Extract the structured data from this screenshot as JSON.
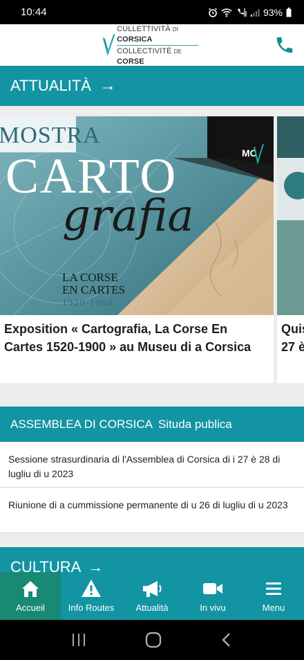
{
  "status_bar": {
    "time": "10:44",
    "battery": "93%"
  },
  "header": {
    "logo_line1_a": "CULLETTIVITÀ",
    "logo_line1_b": "DI",
    "logo_line1_c": "CORSICA",
    "logo_line2_a": "COLLECTIVITÉ",
    "logo_line2_b": "DE",
    "logo_line2_c": "CORSE"
  },
  "attualita": {
    "label": "ATTUALITÀ",
    "arrow": "→",
    "cards": [
      {
        "title": "Exposition « Cartografia, La Corse En Cartes 1520-1900 » au Museu di a Corsica",
        "image": {
          "banner": "MOSTRA",
          "big1": "CARTO",
          "big2": "grafia",
          "sub1": "LA CORSE",
          "sub2": "EN CARTES",
          "years": "1520-1900",
          "badge": "MC"
        }
      },
      {
        "title": "Quis 27 è"
      }
    ]
  },
  "assemblea": {
    "label": "ASSEMBLEA DI CORSICA",
    "sublabel": "Situda publica",
    "items": [
      "Sessione strasurdinaria di l'Assemblea di Corsica di i 27 è 28 di lugliu di u 2023",
      "Riunione di a cummissione permanente di u 26 di lugliu di u 2023"
    ]
  },
  "cultura": {
    "label": "CULTURA",
    "arrow": "→"
  },
  "bottom_nav": {
    "items": [
      {
        "label": "Accueil",
        "icon": "home-icon",
        "active": true
      },
      {
        "label": "Info Routes",
        "icon": "warning-icon",
        "active": false
      },
      {
        "label": "Attualità",
        "icon": "megaphone-icon",
        "active": false
      },
      {
        "label": "In vivu",
        "icon": "video-camera-icon",
        "active": false
      },
      {
        "label": "Menu",
        "icon": "hamburger-menu-icon",
        "active": false
      }
    ]
  },
  "colors": {
    "teal": "#1394a3",
    "active_green": "#188a73",
    "logo_teal": "#25a9a6",
    "phone_teal": "#0f8f8f"
  }
}
